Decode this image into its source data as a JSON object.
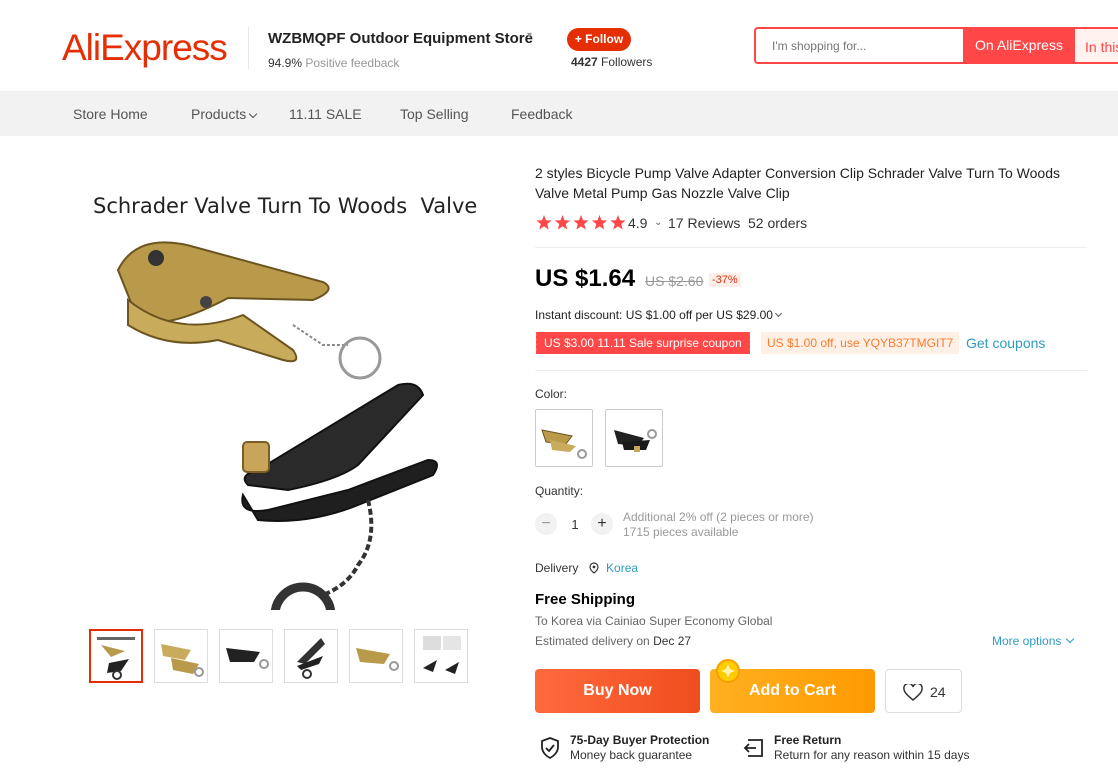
{
  "header": {
    "logo": "AliExpress",
    "store_name": "WZBMQPF Outdoor Equipment Store",
    "feedback_pct": "94.9%",
    "feedback_label": "Positive feedback",
    "follow_label": "+ Follow",
    "followers_count": "4427",
    "followers_label": "Followers",
    "search_placeholder": "I'm shopping for...",
    "search_on_aliexpress": "On AliExpress",
    "search_in_store": "In this store"
  },
  "nav": {
    "items": [
      "Store Home",
      "Products",
      "11.11 SALE",
      "Top Selling",
      "Feedback"
    ]
  },
  "gallery": {
    "main_image_caption": "Schrader Valve Turn To Woods  Valve",
    "thumbnail_count": 6,
    "active_thumbnail": 1
  },
  "product": {
    "title": "2 styles Bicycle Pump Valve Adapter Conversion Clip Schrader Valve Turn To Woods Valve Metal Pump Gas Nozzle Valve Clip",
    "rating": "4.9",
    "star_count": 5,
    "reviews": "17 Reviews",
    "orders": "52 orders",
    "price": "US $1.64",
    "old_price": "US $2.60",
    "discount": "-37%",
    "instant_discount": "Instant discount: US $1.00 off per US $29.00",
    "coupon_red": "US $3.00 11.11 Sale surprise coupon",
    "coupon_orange": "US $1.00 off, use YQYB37TMGIT7",
    "get_coupons": "Get coupons",
    "color_label": "Color:",
    "quantity_label": "Quantity:",
    "quantity": "1",
    "qty_note_1": "Additional 2% off (2 pieces or more)",
    "qty_note_2": "1715 pieces available",
    "delivery_label": "Delivery",
    "delivery_location": "Korea",
    "free_shipping": "Free Shipping",
    "ship_via": "To Korea via Cainiao Super Economy Global",
    "estimated_label": "Estimated delivery on",
    "estimated_date": "Dec 27",
    "more_options": "More options",
    "buy_now": "Buy Now",
    "add_to_cart": "Add to Cart",
    "wishlist_count": "24",
    "protection_title": "75-Day Buyer Protection",
    "protection_sub": "Money back guarantee",
    "return_title": "Free Return",
    "return_sub": "Return for any reason within 15 days"
  },
  "colors": {
    "brand": "#e62e04",
    "search_red": "#ff4747",
    "link_blue": "#2e9cc3",
    "buy_now": "#f04d1e",
    "add_cart": "#ff9a00",
    "star": "#ff4747"
  }
}
